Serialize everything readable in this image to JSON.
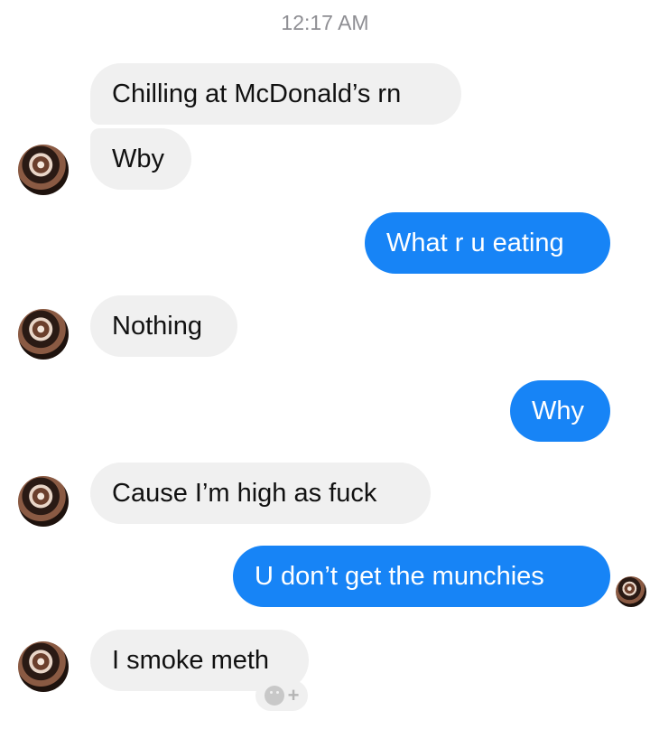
{
  "timestamp": "12:17 AM",
  "messages": [
    {
      "text": "Chilling at McDonald’s rn",
      "sender": "them"
    },
    {
      "text": "Wby",
      "sender": "them"
    },
    {
      "text": "What r u eating",
      "sender": "me"
    },
    {
      "text": "Nothing",
      "sender": "them"
    },
    {
      "text": "Why",
      "sender": "me"
    },
    {
      "text": "Cause I’m high as fuck",
      "sender": "them"
    },
    {
      "text": "U don’t get the munchies",
      "sender": "me"
    },
    {
      "text": "I smoke meth",
      "sender": "them"
    }
  ],
  "reaction_button": {
    "icon": "smiley-icon",
    "plus": "+"
  },
  "colors": {
    "incoming_bubble": "#f0f0f0",
    "outgoing_bubble": "#1784f6",
    "timestamp": "#8e8e93"
  }
}
